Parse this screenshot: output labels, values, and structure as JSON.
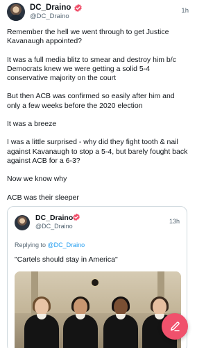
{
  "post": {
    "author_name": "DC_Draino",
    "handle": "@DC_Draino",
    "time": "1h",
    "paragraphs": [
      "Remember the hell we went through to get Justice Kavanaugh appointed?",
      "It was a full media blitz to smear and destroy him b/c Democrats knew we were getting a solid 5-4 conservative majority on the court",
      "But then ACB was confirmed so easily after him and only a few weeks before the 2020 election",
      "It was a breeze",
      "I was a little surprised - why did they fight tooth & nail against Kavanaugh to stop a 5-4, but barely fought back against ACB for a 6-3?",
      "Now we know why",
      "ACB was their sleeper"
    ]
  },
  "quote": {
    "author_name": "DC_Draino",
    "handle": "@DC_Draino",
    "time": "13h",
    "replying_prefix": "Replying to ",
    "replying_to": "@DC_Draino",
    "text": "\"Cartels should stay in America\""
  },
  "colors": {
    "verified_badge": "#f0516c",
    "link": "#1d9bf0",
    "fab": "#f0516c",
    "secondary_text": "#536471"
  },
  "icons": {
    "verified": "verified-badge-icon",
    "compose": "compose-pen-icon"
  }
}
